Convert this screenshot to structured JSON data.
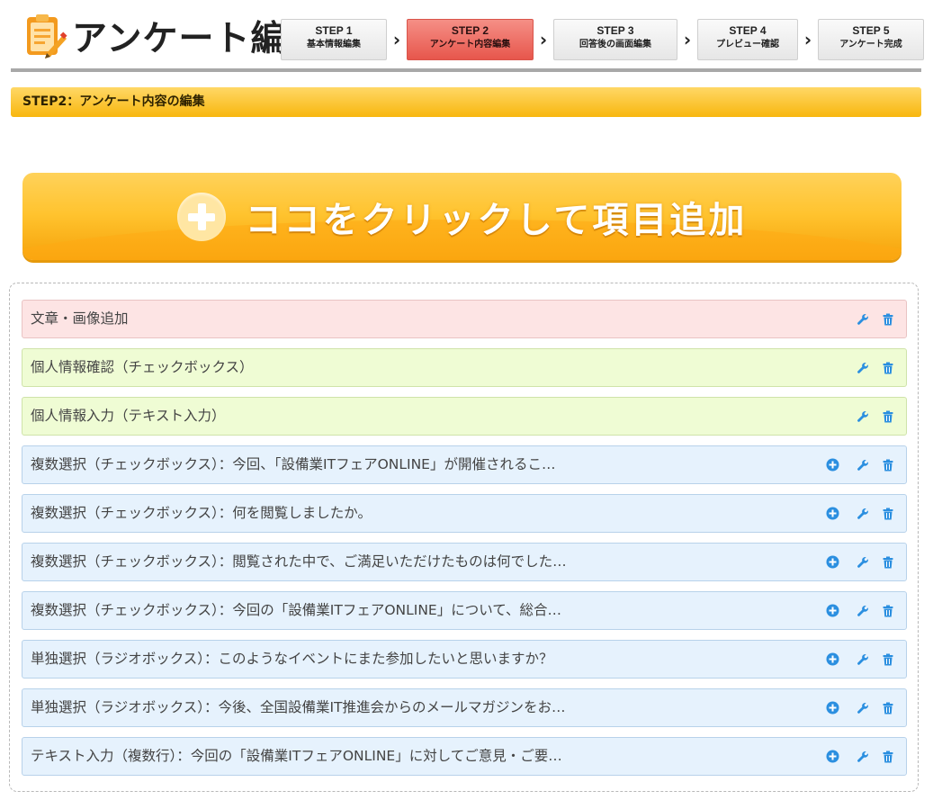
{
  "header": {
    "title": "アンケート編集",
    "steps": [
      {
        "num": "STEP 1",
        "label": "基本情報編集",
        "active": false
      },
      {
        "num": "STEP 2",
        "label": "アンケート内容編集",
        "active": true
      },
      {
        "num": "STEP 3",
        "label": "回答後の画面編集",
        "active": false
      },
      {
        "num": "STEP 4",
        "label": "プレビュー確認",
        "active": false
      },
      {
        "num": "STEP 5",
        "label": "アンケート完成",
        "active": false
      }
    ]
  },
  "banner": {
    "title": "STEP2：アンケート内容の編集"
  },
  "add_button": {
    "label": "ココをクリックして項目追加"
  },
  "items": [
    {
      "label": "文章・画像追加",
      "type": "pink",
      "has_add": false
    },
    {
      "label": "個人情報確認（チェックボックス）",
      "type": "green",
      "has_add": false
    },
    {
      "label": "個人情報入力（テキスト入力）",
      "type": "green",
      "has_add": false
    },
    {
      "label": "複数選択（チェックボックス）：今回、「設備業ITフェアONLINE」が開催されるこ…",
      "type": "blue",
      "has_add": true
    },
    {
      "label": "複数選択（チェックボックス）：何を閲覧しましたか。",
      "type": "blue",
      "has_add": true
    },
    {
      "label": "複数選択（チェックボックス）：閲覧された中で、ご満足いただけたものは何でした…",
      "type": "blue",
      "has_add": true
    },
    {
      "label": "複数選択（チェックボックス）：今回の「設備業ITフェアONLINE」について、総合…",
      "type": "blue",
      "has_add": true
    },
    {
      "label": "単独選択（ラジオボックス）：このようなイベントにまた参加したいと思いますか？",
      "type": "blue",
      "has_add": true
    },
    {
      "label": "単独選択（ラジオボックス）：今後、全国設備業IT推進会からのメールマガジンをお…",
      "type": "blue",
      "has_add": true
    },
    {
      "label": "テキスト入力（複数行）：今回の「設備業ITフェアONLINE」に対してご意見・ご要…",
      "type": "blue",
      "has_add": true
    }
  ],
  "colors": {
    "icon_blue": "#2b8fe0",
    "active_step": "#e7564c",
    "banner": "#f8b70e",
    "add_button": "#ffc32e"
  },
  "icons": {
    "add": "plus-circle-icon",
    "edit": "wrench-icon",
    "delete": "trash-icon"
  }
}
